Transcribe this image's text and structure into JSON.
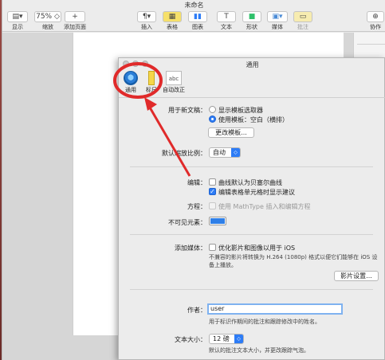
{
  "window": {
    "title": "未命名"
  },
  "toolbar": {
    "items": [
      {
        "label": "显示",
        "icon": "sidebar-icon"
      },
      {
        "label": "缩放",
        "value": "75%"
      },
      {
        "label": "添加页面",
        "icon": "plus-icon"
      },
      {
        "label": "插入",
        "icon": "paragraph-icon"
      },
      {
        "label": "表格",
        "icon": "table-icon"
      },
      {
        "label": "图表",
        "icon": "chart-icon"
      },
      {
        "label": "文本",
        "icon": "text-icon"
      },
      {
        "label": "形状",
        "icon": "shape-icon"
      },
      {
        "label": "媒体",
        "icon": "media-icon"
      },
      {
        "label": "批注",
        "icon": "comment-icon"
      },
      {
        "label": "协作",
        "icon": "collaborate-icon"
      }
    ]
  },
  "prefs": {
    "title": "通用",
    "tabs": [
      {
        "label": "通用",
        "icon": "gear-icon"
      },
      {
        "label": "标尺",
        "icon": "ruler-icon"
      },
      {
        "label": "自动改正",
        "icon": "abc-icon",
        "icon_text": "abc"
      }
    ],
    "new_doc": {
      "label": "用于新文稿：",
      "option_show": "显示模板选取器",
      "option_use": "使用模板：空白（横排）",
      "change_button": "更改模板..."
    },
    "zoom": {
      "label": "默认缩放比例：",
      "value": "自动"
    },
    "edit": {
      "label": "编辑：",
      "curve": "曲线默认为贝塞尔曲线",
      "hints": "编辑表格单元格时显示建议"
    },
    "equation": {
      "label": "方程：",
      "text": "使用 MathType 插入和编辑方程"
    },
    "invisibles": {
      "label": "不可见元素：",
      "color": "#2e7fe8"
    },
    "media": {
      "label": "添加媒体：",
      "optimize": "优化影片和图像以用于 iOS",
      "note": "不兼容的影片将转换为 H.264 (1080p) 格式以便它们能够在 iOS 设备上播放。",
      "settings_button": "影片设置..."
    },
    "author": {
      "label": "作者：",
      "value": "user",
      "note": "用于标识作期间的批注和跟踪修改中的姓名。"
    },
    "text_size": {
      "label": "文本大小：",
      "value": "12 磅",
      "note": "默认的批注文本大小，并更改跟踪气泡。"
    }
  },
  "annotation": {
    "color": "#e02a2a"
  }
}
